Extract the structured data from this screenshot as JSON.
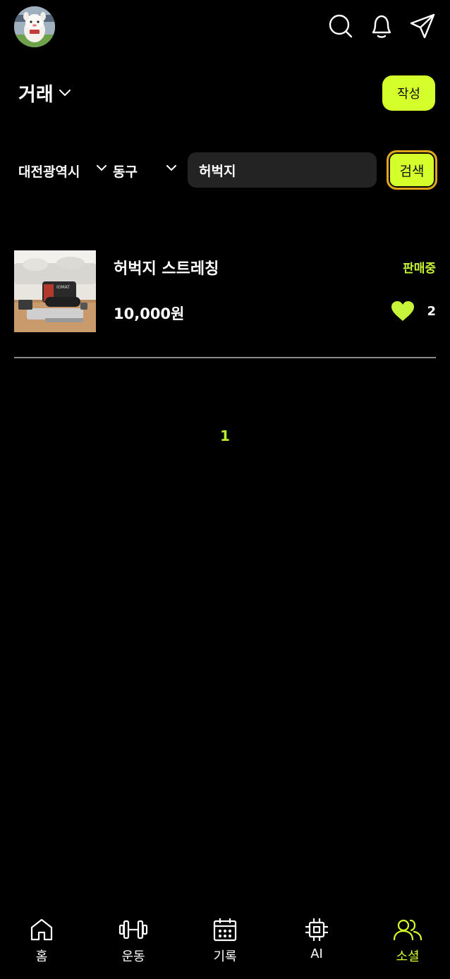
{
  "header": {
    "icons": [
      "search-icon",
      "bell-icon",
      "send-icon"
    ]
  },
  "board": {
    "title": "거래",
    "write_label": "작성"
  },
  "filters": {
    "city": "대전광역시",
    "district": "동구",
    "search_value": "허벅지",
    "search_button": "검색"
  },
  "listings": [
    {
      "title": "허벅지 스트레칭",
      "price": "10,000원",
      "status": "판매중",
      "likes": "2",
      "thumb_text": "IOMAT"
    }
  ],
  "pagination": {
    "current": "1"
  },
  "nav": {
    "items": [
      {
        "label": "홈",
        "icon": "home-icon"
      },
      {
        "label": "운동",
        "icon": "dumbbell-icon"
      },
      {
        "label": "기록",
        "icon": "calendar-icon"
      },
      {
        "label": "AI",
        "icon": "chip-icon"
      },
      {
        "label": "소셜",
        "icon": "users-icon"
      }
    ],
    "active": "소셜"
  },
  "colors": {
    "accent": "#d4ff2a",
    "status": "#c6f53a",
    "background": "#000000"
  }
}
